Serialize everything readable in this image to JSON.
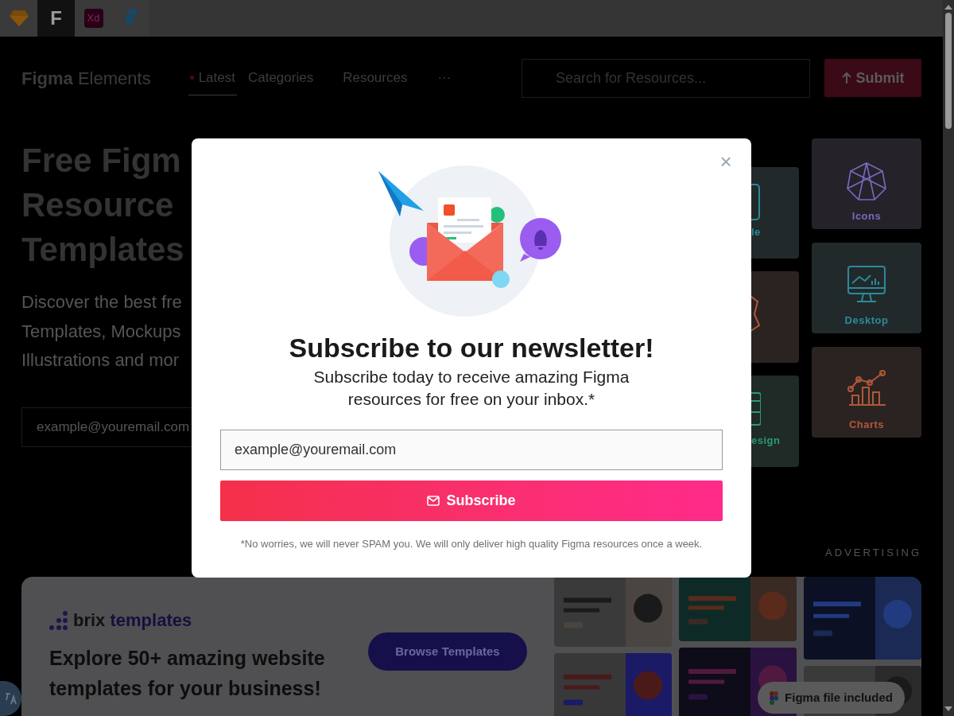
{
  "toolbar": {
    "tools": [
      {
        "kind": "sketch",
        "selected": false
      },
      {
        "kind": "letter",
        "label": "F",
        "selected": true
      },
      {
        "kind": "xd",
        "label": "Xd",
        "selected": false
      },
      {
        "kind": "framer",
        "selected": false
      }
    ]
  },
  "nav": {
    "logo": {
      "bold": "Figma",
      "light": "Elements"
    },
    "links": [
      {
        "label": "Latest",
        "selected": true
      },
      {
        "label": "Categories",
        "selected": false
      },
      {
        "label": "Resources",
        "selected": false
      },
      {
        "label": "···",
        "selected": false
      }
    ],
    "search": {
      "placeholder": "Search for Resources..."
    },
    "submit_button": "Submit"
  },
  "hero": {
    "title_lines": [
      "Free Figm",
      "Resource",
      "Templates"
    ],
    "subtitle_lines": [
      "Discover the best fre",
      "Templates, Mockups",
      "Illustrations and mor"
    ],
    "email_field": {
      "placeholder": "example@youremail.com"
    }
  },
  "category_cards": [
    {
      "kind": "phone",
      "label": "le",
      "color": "#2a8a9a"
    },
    {
      "kind": "badge",
      "color": "#b0583a"
    },
    {
      "kind": "layout",
      "label": "esign",
      "color": "#2a9a72"
    },
    {
      "kind": "polyhedron",
      "label": "Icons",
      "color": "#7a6ac0"
    },
    {
      "kind": "monitor",
      "label": "Desktop",
      "color": "#2a8a9a"
    },
    {
      "kind": "chart",
      "label": "Charts",
      "color": "#b0583a"
    }
  ],
  "advertising": {
    "label": "ADVERTISING",
    "brand": {
      "name": "brix",
      "accent": "templates"
    },
    "headline_lines": [
      "Explore 50+ amazing website",
      "templates for your business!"
    ],
    "button": "Browse Templates",
    "badge": "Figma file included",
    "previews": [
      {
        "kind": "picture"
      },
      {
        "kind": "picture"
      },
      {
        "kind": "picture"
      },
      {
        "kind": "picture"
      },
      {
        "kind": "picture"
      },
      {
        "kind": "picture"
      }
    ]
  },
  "modal": {
    "close": "×",
    "title": "Subscribe to our newsletter!",
    "text": "Subscribe today to receive amazing Figma resources for free on your inbox.*",
    "email": {
      "placeholder": "example@youremail.com"
    },
    "button": "Subscribe",
    "note": "*No worries, we will never SPAM you. We will only deliver high quality Figma resources once a week."
  }
}
